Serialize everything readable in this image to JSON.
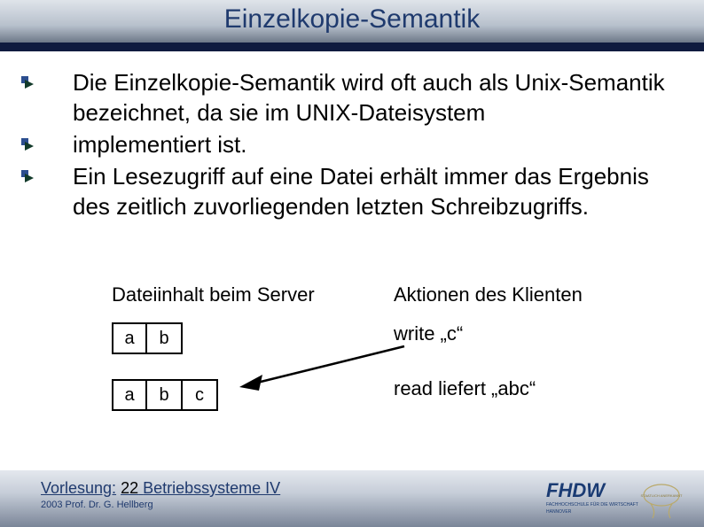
{
  "title": "Einzelkopie-Semantik",
  "bullets": [
    "Die Einzelkopie-Semantik wird oft auch als Unix-Semantik bezeichnet, da sie im UNIX-Dateisystem",
    "implementiert ist.",
    "Ein Lesezugriff auf eine Datei erhält immer das Ergebnis des zeitlich zuvorliegenden letzten Schreibzugriffs."
  ],
  "illustration": {
    "server_header": "Dateiinhalt beim Server",
    "client_header": "Aktionen des Klienten",
    "row1_cells": [
      "a",
      "b"
    ],
    "row2_cells": [
      "a",
      "b",
      "c"
    ],
    "action_write": "write „c“",
    "action_read": "read liefert „abc“"
  },
  "footer": {
    "lecture_label": "Vorlesung:",
    "lecture_number": "22",
    "lecture_title": "Betriebssysteme IV",
    "copyright": "2003 Prof. Dr. G. Hellberg"
  },
  "logo": {
    "main_text": "FHDW",
    "sub1": "FACHHOCHSCHULE FÜR DIE WIRTSCHAFT",
    "sub2": "HANNOVER",
    "seal": "STAATLICH ANERKANNT"
  }
}
